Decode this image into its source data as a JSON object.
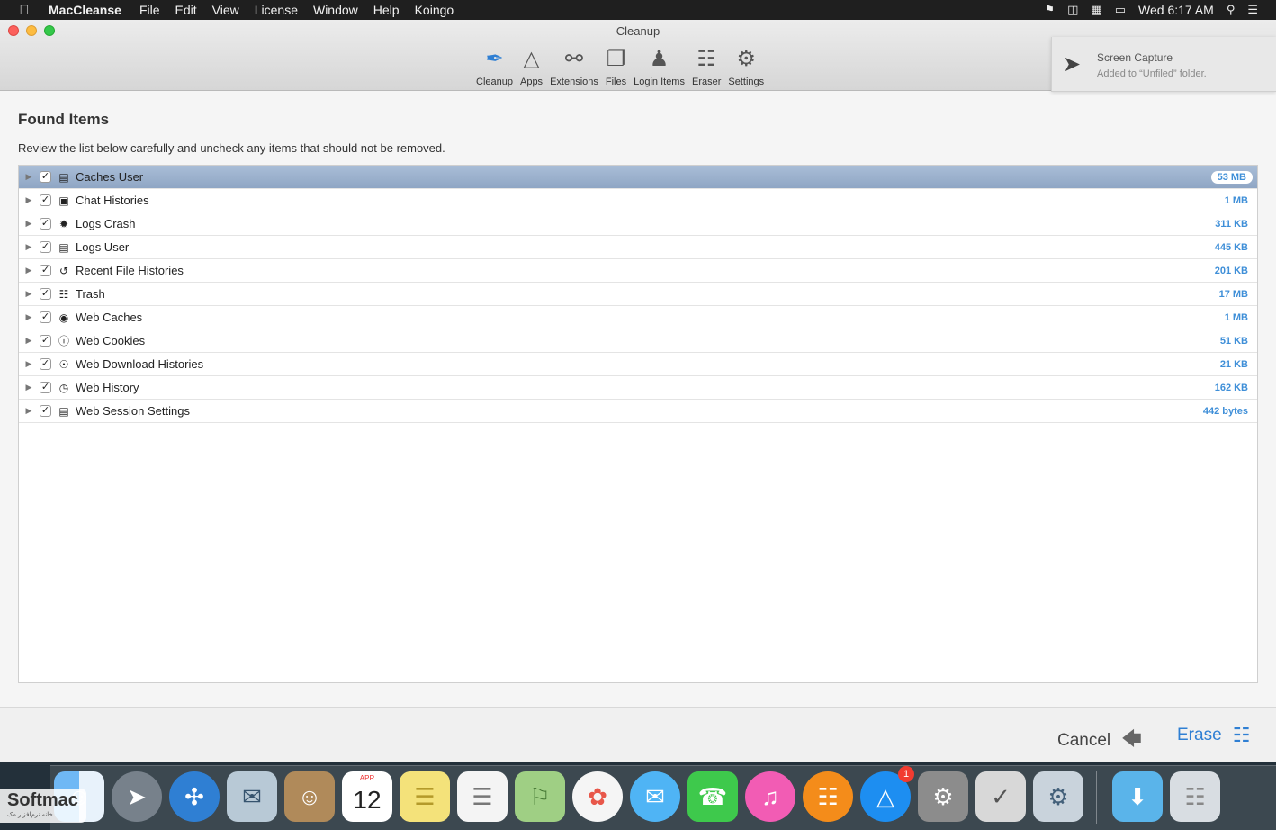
{
  "menubar": {
    "app_name": "MacCleanse",
    "menus": [
      "File",
      "Edit",
      "View",
      "License",
      "Window",
      "Help",
      "Koingo"
    ],
    "clock": "Wed 6:17 AM"
  },
  "window": {
    "title": "Cleanup",
    "toolbar": [
      {
        "label": "Cleanup",
        "icon": "feather-icon",
        "active": true
      },
      {
        "label": "Apps",
        "icon": "apps-icon",
        "active": false
      },
      {
        "label": "Extensions",
        "icon": "share-icon",
        "active": false
      },
      {
        "label": "Files",
        "icon": "files-icon",
        "active": false
      },
      {
        "label": "Login Items",
        "icon": "user-icon",
        "active": false
      },
      {
        "label": "Eraser",
        "icon": "trash-icon",
        "active": false
      },
      {
        "label": "Settings",
        "icon": "settings-icon",
        "active": false
      }
    ]
  },
  "notification": {
    "title": "Screen Capture",
    "body": "Added to “Unfiled” folder."
  },
  "content": {
    "title": "Found Items",
    "description": "Review the list below carefully and uncheck any items that should not be removed.",
    "items": [
      {
        "label": "Caches User",
        "size": "53 MB",
        "icon": "drawer-icon",
        "checked": true,
        "selected": true
      },
      {
        "label": "Chat Histories",
        "size": "1 MB",
        "icon": "chat-icon",
        "checked": true,
        "selected": false
      },
      {
        "label": "Logs Crash",
        "size": "311 KB",
        "icon": "bug-icon",
        "checked": true,
        "selected": false
      },
      {
        "label": "Logs User",
        "size": "445 KB",
        "icon": "document-icon",
        "checked": true,
        "selected": false
      },
      {
        "label": "Recent File Histories",
        "size": "201 KB",
        "icon": "history-icon",
        "checked": true,
        "selected": false
      },
      {
        "label": "Trash",
        "size": "17 MB",
        "icon": "trash-icon",
        "checked": true,
        "selected": false
      },
      {
        "label": "Web Caches",
        "size": "1 MB",
        "icon": "globe-icon",
        "checked": true,
        "selected": false
      },
      {
        "label": "Web Cookies",
        "size": "51 KB",
        "icon": "info-icon",
        "checked": true,
        "selected": false
      },
      {
        "label": "Web Download Histories",
        "size": "21 KB",
        "icon": "download-icon",
        "checked": true,
        "selected": false
      },
      {
        "label": "Web History",
        "size": "162 KB",
        "icon": "clock-icon",
        "checked": true,
        "selected": false
      },
      {
        "label": "Web Session Settings",
        "size": "442 bytes",
        "icon": "document-icon",
        "checked": true,
        "selected": false
      }
    ]
  },
  "footer": {
    "cancel_label": "Cancel",
    "erase_label": "Erase"
  },
  "dock": {
    "apps": [
      {
        "name": "finder-icon",
        "color": "#5fa8f0"
      },
      {
        "name": "launchpad-icon",
        "color": "#7a8590"
      },
      {
        "name": "safari-icon",
        "color": "#2f7fd3"
      },
      {
        "name": "mail-icon",
        "color": "#b8c9d6"
      },
      {
        "name": "contacts-icon",
        "color": "#b08a5a"
      },
      {
        "name": "calendar-icon",
        "color": "#ffffff",
        "month": "APR",
        "day": "12"
      },
      {
        "name": "notes-icon",
        "color": "#f4e27a"
      },
      {
        "name": "reminders-icon",
        "color": "#f4f4f4"
      },
      {
        "name": "maps-icon",
        "color": "#9fcf84"
      },
      {
        "name": "photos-icon",
        "color": "#f5f5f5"
      },
      {
        "name": "messages-icon",
        "color": "#4fb4f5"
      },
      {
        "name": "facetime-icon",
        "color": "#3ec94c"
      },
      {
        "name": "itunes-icon",
        "color": "#f25cb4"
      },
      {
        "name": "ibooks-icon",
        "color": "#f48c1a"
      },
      {
        "name": "app-store-icon",
        "color": "#1d8ef1",
        "badge": "1"
      },
      {
        "name": "system-preferences-icon",
        "color": "#8c8c8c"
      },
      {
        "name": "maccleanse-icon",
        "color": "#d8d8d8"
      },
      {
        "name": "automator-icon",
        "color": "#c9d3dc"
      }
    ],
    "right_apps": [
      {
        "name": "downloads-folder-icon",
        "color": "#5ab4ea"
      },
      {
        "name": "dock-trash-icon",
        "color": "#d8dde2"
      }
    ]
  },
  "watermark": {
    "brand": "Softmac",
    "subtitle": "خانه نرم‌افزار مک"
  }
}
